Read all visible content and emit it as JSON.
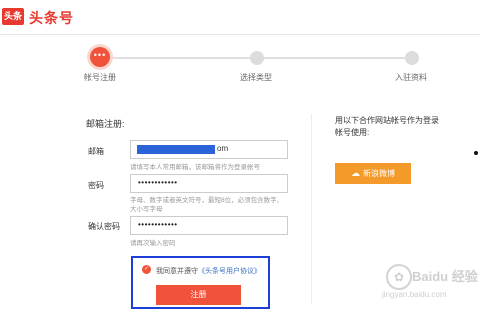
{
  "header": {
    "logo_badge": "头条",
    "logo_text": "头条号"
  },
  "steps": [
    {
      "label": "帐号注册",
      "active": true,
      "dots": "•••"
    },
    {
      "label": "选择类型",
      "active": false
    },
    {
      "label": "入驻资料",
      "active": false
    }
  ],
  "form": {
    "title": "邮箱注册:",
    "email": {
      "label": "邮箱",
      "value_visible": "om",
      "hint": "请填写本人常用邮箱，该邮箱将作为登录帐号"
    },
    "password": {
      "label": "密码",
      "value": "••••••••••••",
      "hint_line1": "字母、数字或者英文符号，最短8位，必须包含数字、",
      "hint_line2": "大小写字母"
    },
    "confirm": {
      "label": "确认密码",
      "value": "••••••••••••",
      "hint": "请再次输入密码"
    },
    "agree": {
      "check": "✓",
      "text": "我同意并遵守",
      "link": "《头条号用户协议》"
    },
    "register_label": "注册"
  },
  "partner": {
    "text": "用以下合作网站帐号作为登录帐号使用:",
    "weibo_label": "新浪微博",
    "weibo_icon": "weibo-icon"
  },
  "watermark": {
    "text": "Baidu 经验",
    "url": "jingyan.baidu.com"
  },
  "colors": {
    "brand": "#e8392f",
    "accent": "#f0533a",
    "weibo": "#f39a2a",
    "highlight": "#1c3fd6"
  }
}
